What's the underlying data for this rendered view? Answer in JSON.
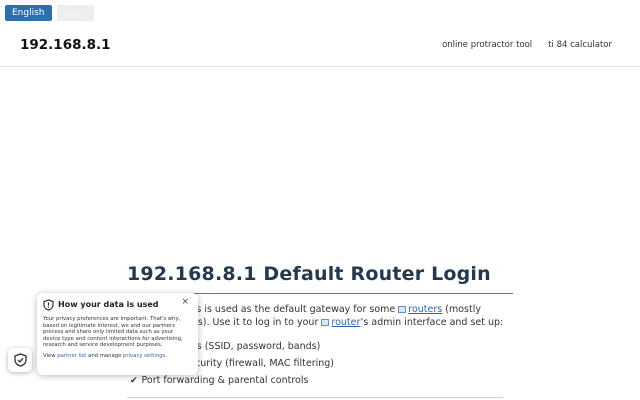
{
  "language_bar": {
    "english_label": "English",
    "secondary_label": "عربي"
  },
  "header": {
    "site_title": "192.168.8.1",
    "nav": [
      "online protractor tool",
      "ti 84 calculator"
    ]
  },
  "main": {
    "title": "192.168.8.1 Default Router Login",
    "intro_part1": "This IP address is used as the default gateway for some",
    "routers_link": "routers",
    "intro_part2": "(mostly Huawei models). Use it to log in to your",
    "router_link": "router",
    "intro_part3": "’s admin interface and set up:",
    "features": [
      "WiFi settings (SSID, password, bands)",
      "Network security (firewall, MAC filtering)",
      "Port forwarding & parental controls"
    ],
    "check_glyph": "✔"
  },
  "privacy": {
    "title": "How your data is used",
    "close_glyph": "×",
    "body": "Your privacy preferences are important. That's why, based on legitimate interest, we and our partners process and share only limited data such as your device type and content interactions for advertising, research and service development purposes.",
    "footer_prefix": "View",
    "partner_link": "partner list",
    "footer_mid": "and manage",
    "settings_link": "privacy settings",
    "footer_suffix": "."
  }
}
